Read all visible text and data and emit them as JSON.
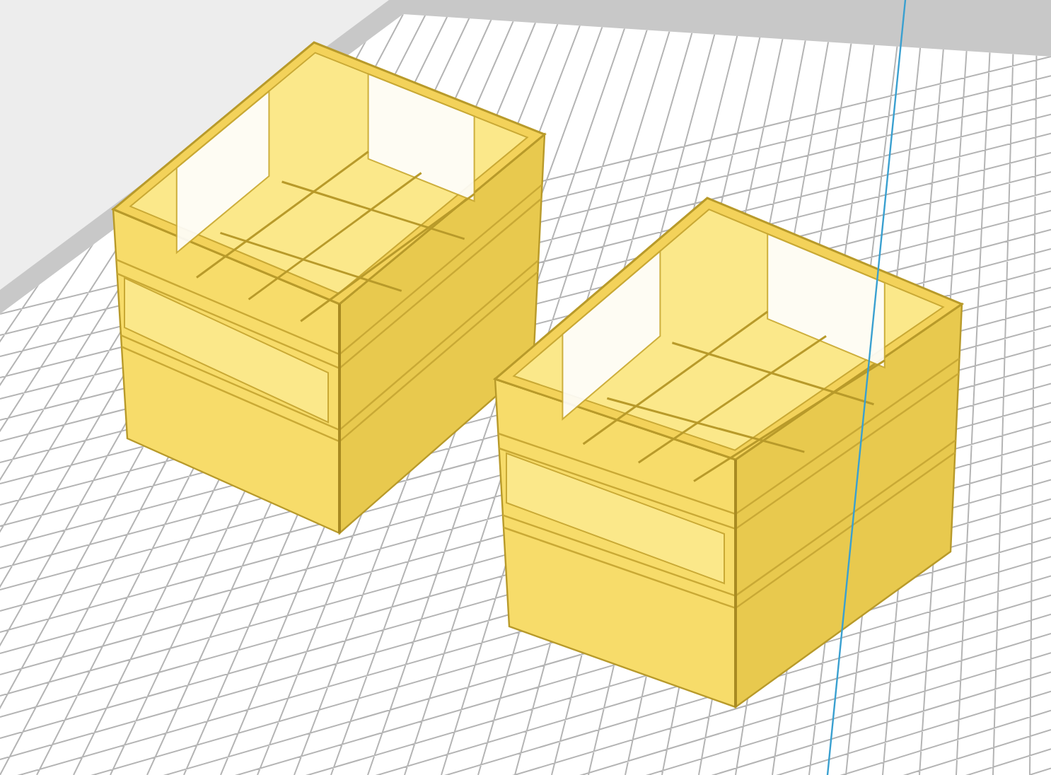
{
  "viewport": {
    "objects": [
      {
        "kind": "crate"
      },
      {
        "kind": "crate"
      }
    ]
  }
}
